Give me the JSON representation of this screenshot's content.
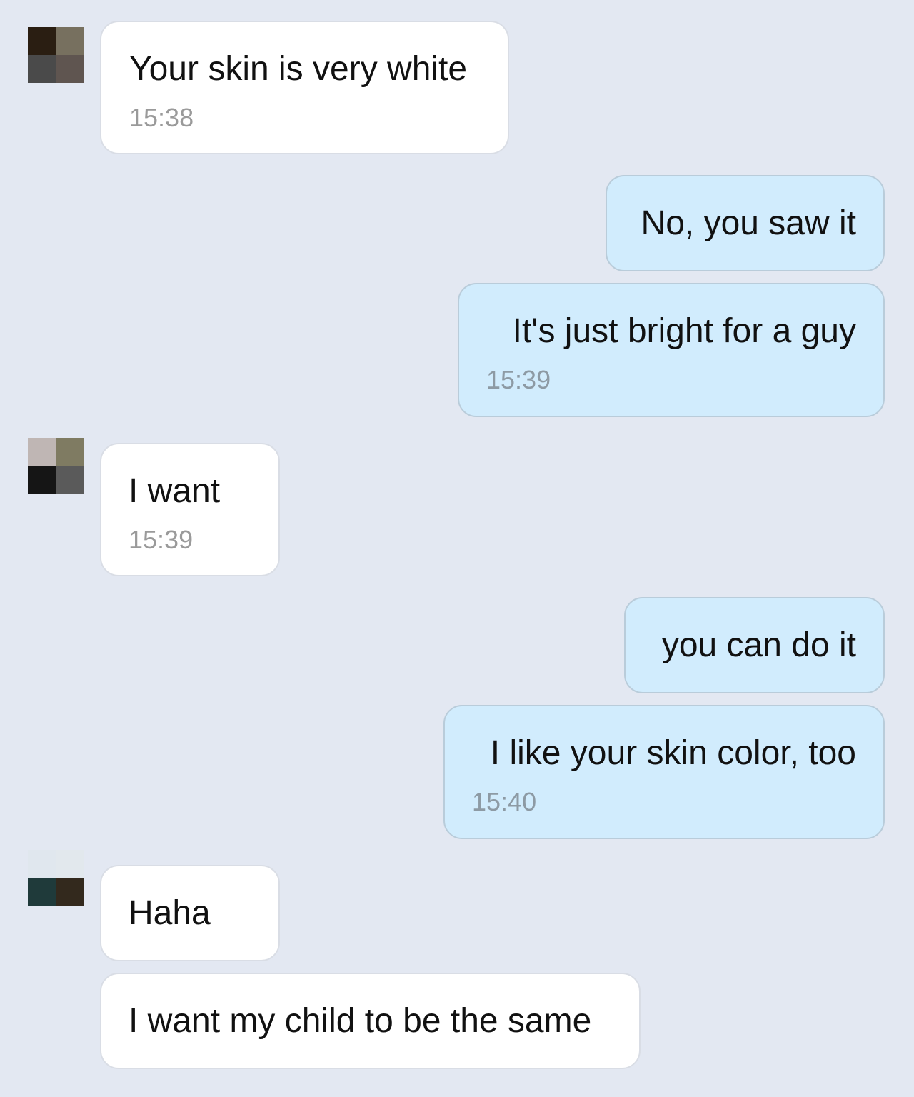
{
  "colors": {
    "background": "#e3e8f2",
    "incoming_bubble": "#ffffff",
    "outgoing_bubble": "#d1ecfd",
    "timestamp": "#9a9a9a"
  },
  "messages": [
    {
      "direction": "incoming",
      "text": "Your skin is very white",
      "time": "15:38"
    },
    {
      "direction": "outgoing",
      "text": "No, you saw it"
    },
    {
      "direction": "outgoing",
      "text": "It's just bright for a guy",
      "time": "15:39"
    },
    {
      "direction": "incoming",
      "text": "I want",
      "time": "15:39"
    },
    {
      "direction": "outgoing",
      "text": "you can do it"
    },
    {
      "direction": "outgoing",
      "text": "I like your skin color, too",
      "time": "15:40"
    },
    {
      "direction": "incoming",
      "text": "Haha"
    },
    {
      "direction": "incoming",
      "text": "I want my child to be the same"
    }
  ]
}
